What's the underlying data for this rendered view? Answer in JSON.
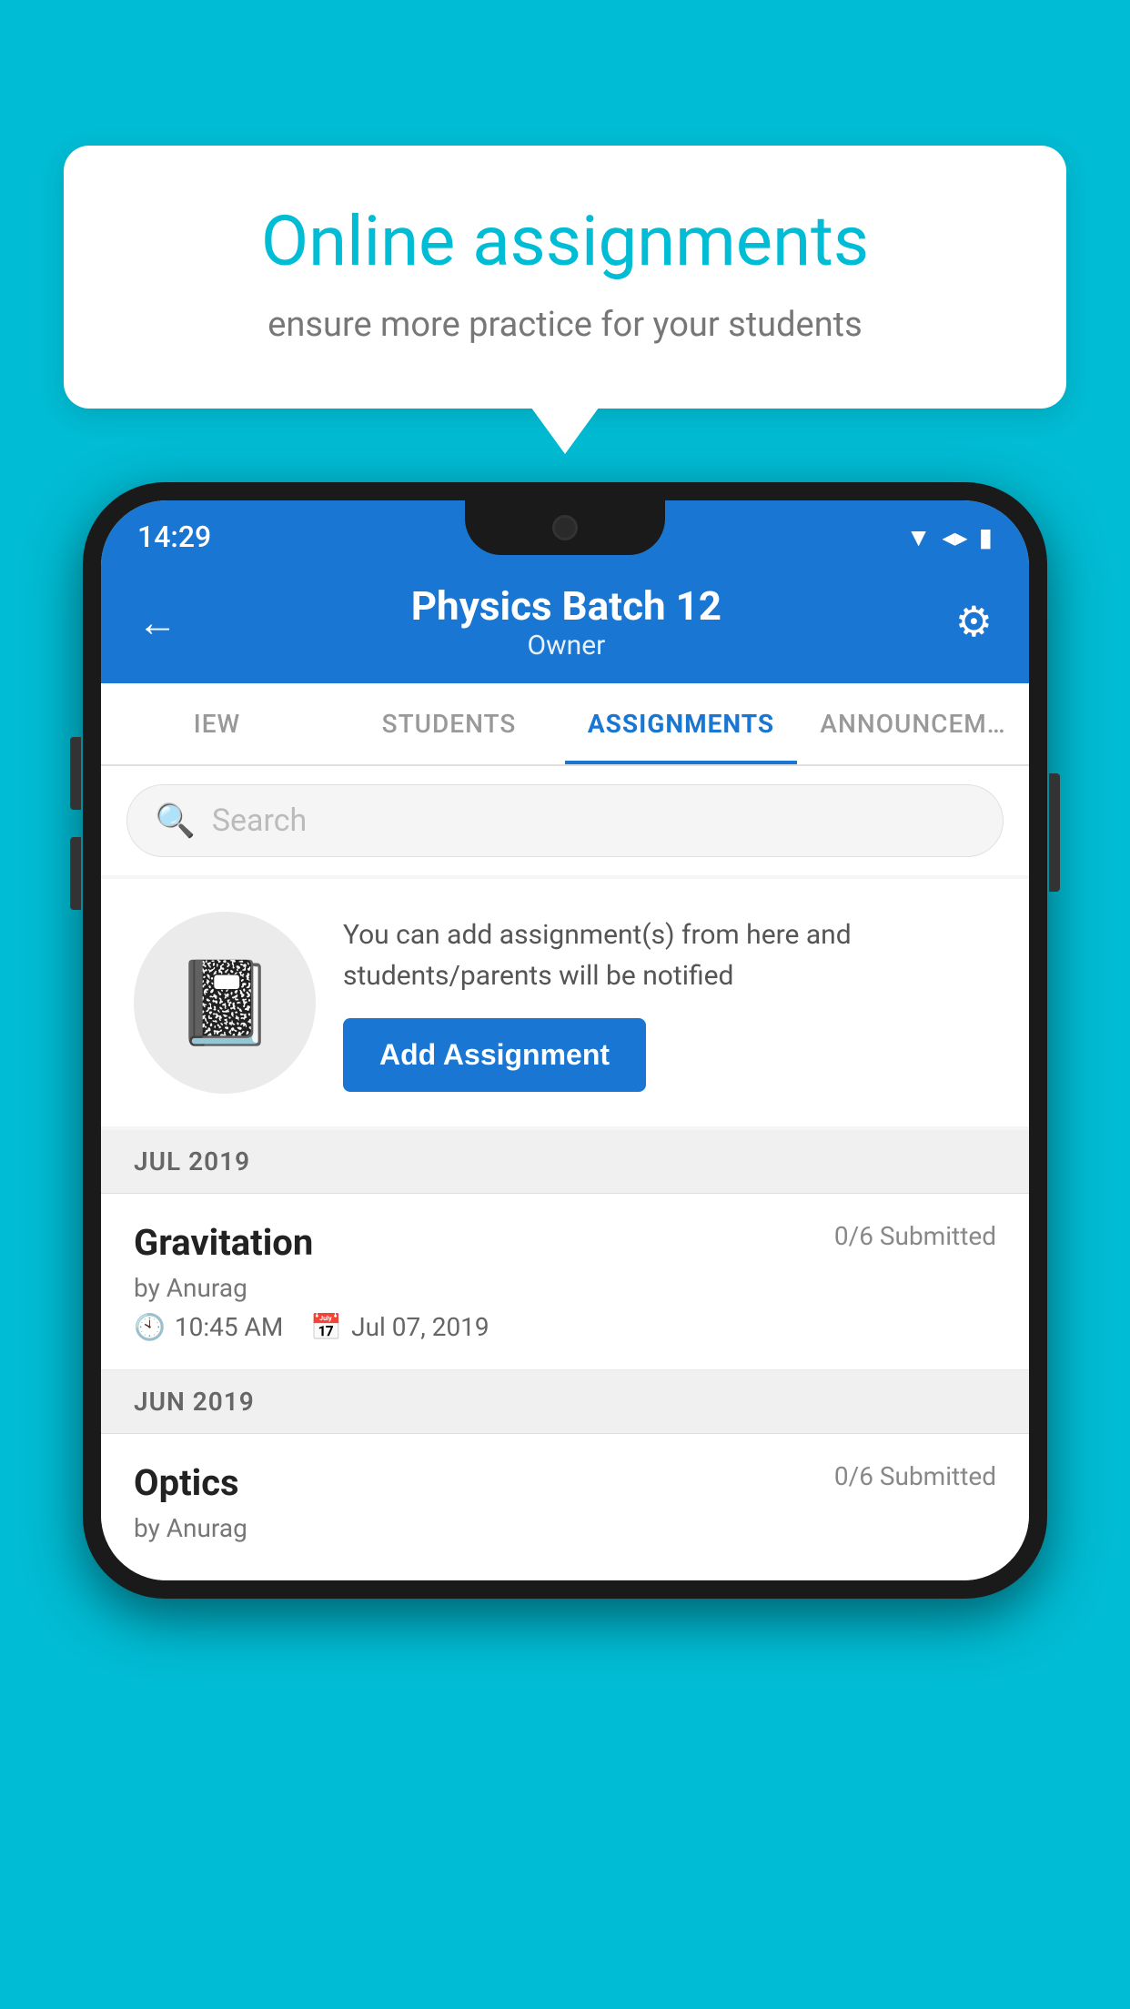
{
  "background_color": "#00BCD4",
  "speech_bubble": {
    "title": "Online assignments",
    "subtitle": "ensure more practice for your students"
  },
  "phone": {
    "status_bar": {
      "time": "14:29",
      "icons": [
        "wifi",
        "signal",
        "battery"
      ]
    },
    "header": {
      "title": "Physics Batch 12",
      "subtitle": "Owner",
      "back_label": "←",
      "settings_label": "⚙"
    },
    "tabs": [
      {
        "label": "IEW",
        "active": false
      },
      {
        "label": "STUDENTS",
        "active": false
      },
      {
        "label": "ASSIGNMENTS",
        "active": true
      },
      {
        "label": "ANNOUNCEM…",
        "active": false
      }
    ],
    "search": {
      "placeholder": "Search"
    },
    "promo": {
      "description": "You can add assignment(s) from here and students/parents will be notified",
      "button_label": "Add Assignment"
    },
    "sections": [
      {
        "month_label": "JUL 2019",
        "assignments": [
          {
            "name": "Gravitation",
            "submitted": "0/6 Submitted",
            "by": "by Anurag",
            "time": "10:45 AM",
            "date": "Jul 07, 2019"
          }
        ]
      },
      {
        "month_label": "JUN 2019",
        "assignments": [
          {
            "name": "Optics",
            "submitted": "0/6 Submitted",
            "by": "by Anurag",
            "time": "",
            "date": ""
          }
        ]
      }
    ]
  }
}
